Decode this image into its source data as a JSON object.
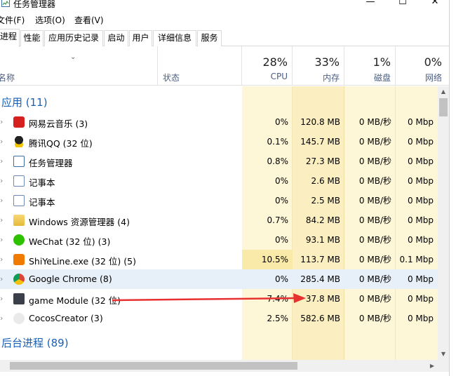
{
  "window": {
    "title": "任务管理器",
    "min": "—",
    "max": "☐",
    "close": "✕"
  },
  "menu": {
    "file": "文件(F)",
    "options": "选项(O)",
    "view": "查看(V)"
  },
  "tabs": [
    "进程",
    "性能",
    "应用历史记录",
    "启动",
    "用户",
    "详细信息",
    "服务"
  ],
  "header": {
    "name": "名称",
    "status": "状态",
    "cpu_pct": "28%",
    "cpu": "CPU",
    "mem_pct": "33%",
    "mem": "内存",
    "disk_pct": "1%",
    "disk": "磁盘",
    "net_pct": "0%",
    "net": "网络"
  },
  "groups": {
    "apps": "应用 (11)",
    "background": "后台进程 (89)"
  },
  "processes": [
    {
      "name": "网易云音乐 (3)",
      "cpu": "0%",
      "mem": "120.8 MB",
      "disk": "0 MB/秒",
      "net": "0 Mbp",
      "icon": "netease-music-icon"
    },
    {
      "name": "腾讯QQ (32 位)",
      "cpu": "0.1%",
      "mem": "145.7 MB",
      "disk": "0 MB/秒",
      "net": "0 Mbp",
      "icon": "qq-icon"
    },
    {
      "name": "任务管理器",
      "cpu": "0.8%",
      "mem": "27.3 MB",
      "disk": "0 MB/秒",
      "net": "0 Mbp",
      "icon": "task-manager-icon"
    },
    {
      "name": "记事本",
      "cpu": "0%",
      "mem": "2.6 MB",
      "disk": "0 MB/秒",
      "net": "0 Mbp",
      "icon": "notepad-icon"
    },
    {
      "name": "记事本",
      "cpu": "0%",
      "mem": "2.5 MB",
      "disk": "0 MB/秒",
      "net": "0 Mbp",
      "icon": "notepad-icon"
    },
    {
      "name": "Windows 资源管理器 (4)",
      "cpu": "0.7%",
      "mem": "84.2 MB",
      "disk": "0 MB/秒",
      "net": "0 Mbp",
      "icon": "folder-icon"
    },
    {
      "name": "WeChat (32 位) (3)",
      "cpu": "0%",
      "mem": "93.1 MB",
      "disk": "0 MB/秒",
      "net": "0 Mbp",
      "icon": "wechat-icon"
    },
    {
      "name": "ShiYeLine.exe (32 位) (5)",
      "cpu": "10.5%",
      "mem": "113.7 MB",
      "disk": "0 MB/秒",
      "net": "0.1 Mbp",
      "icon": "shiyeline-icon"
    },
    {
      "name": "Google Chrome (8)",
      "cpu": "0%",
      "mem": "285.4 MB",
      "disk": "0 MB/秒",
      "net": "0 Mbp",
      "icon": "chrome-icon"
    },
    {
      "name": "game Module (32 位)",
      "cpu": "7.4%",
      "mem": "37.8 MB",
      "disk": "0 MB/秒",
      "net": "0 Mbp",
      "icon": "game-module-icon"
    },
    {
      "name": "CocosCreator (3)",
      "cpu": "2.5%",
      "mem": "582.6 MB",
      "disk": "0 MB/秒",
      "net": "0 Mbp",
      "icon": "cocos-icon"
    }
  ],
  "colors": {
    "accent_blue": "#1a5fb4",
    "cpu_tint": "#fdf7d8",
    "mem_tint": "#fbeec0",
    "cpu_hot": "#faeaaa",
    "arrow": "#e8312f"
  }
}
